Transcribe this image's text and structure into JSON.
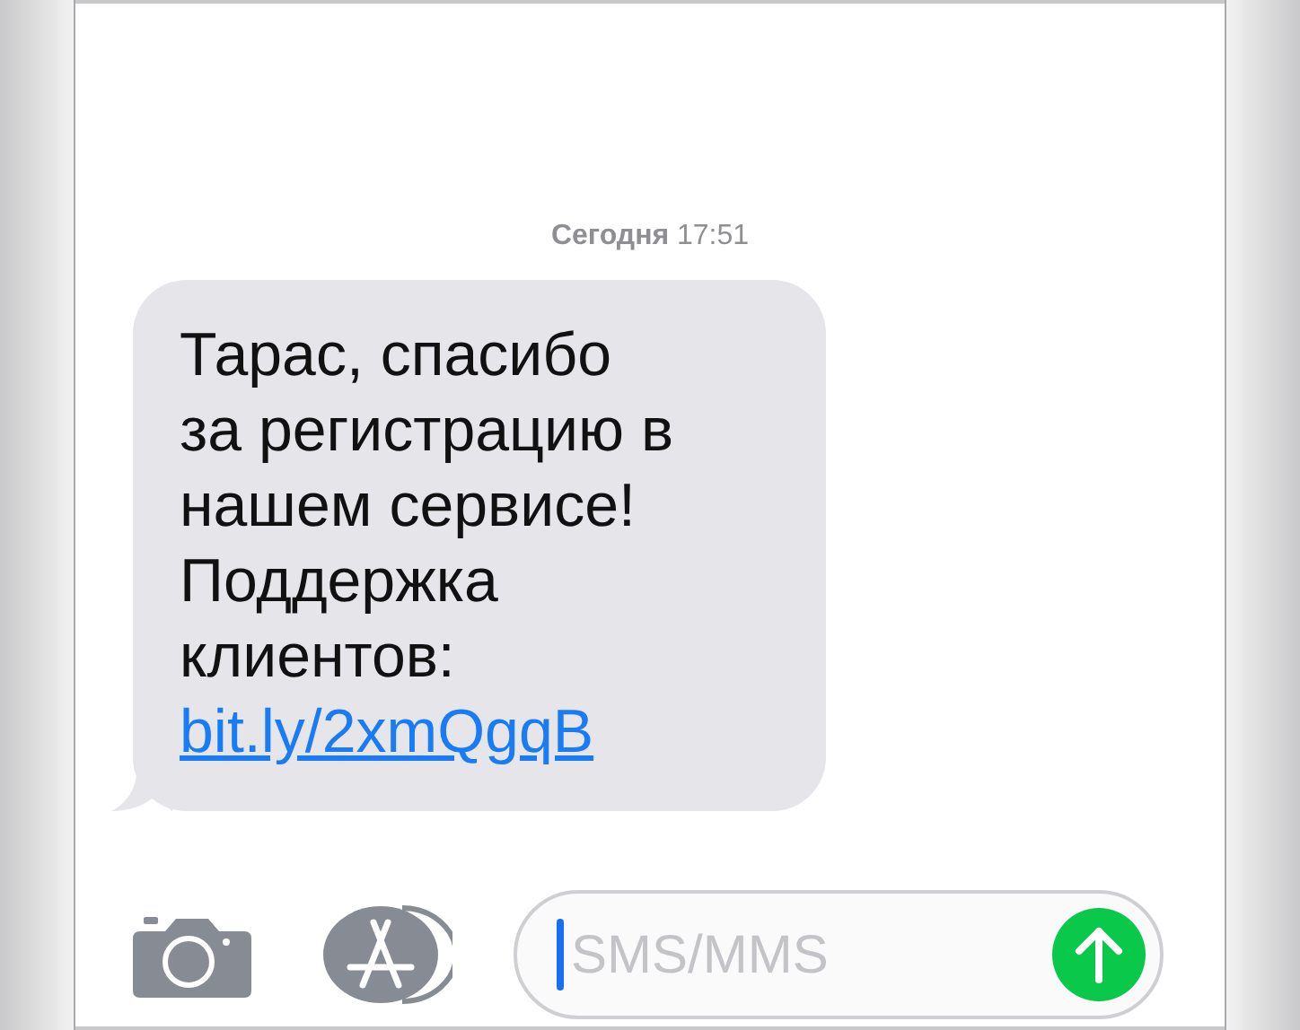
{
  "timestamp": "**Сегодня** 17:51",
  "messages": [
    {
      "text": "Тарас, спасибо\nза регистрацию в\nнашем сервисе!\nПоддержка\nклиентов:",
      "link": "bit.ly/2xmQgqB"
    }
  ],
  "composer": {
    "placeholder": "SMS/MMS"
  }
}
